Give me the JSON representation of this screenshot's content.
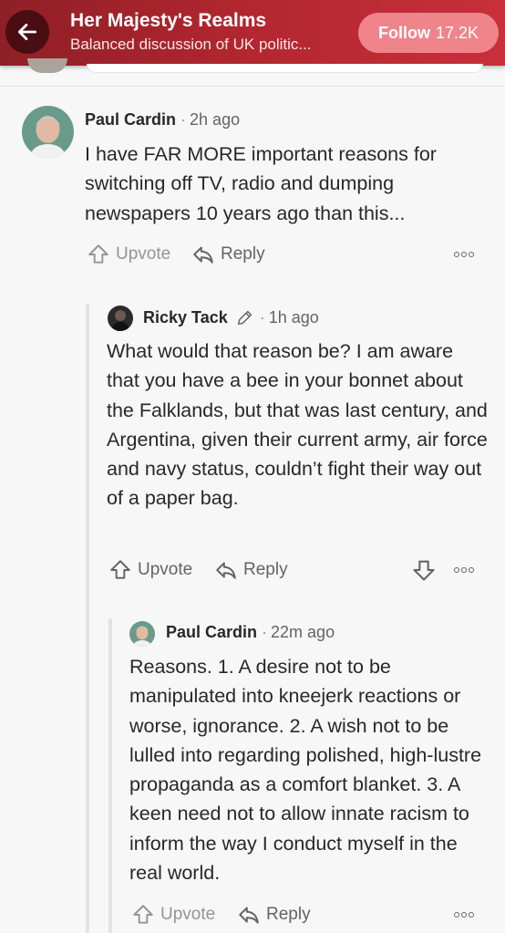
{
  "header": {
    "title": "Her Majesty's Realms",
    "subtitle": "Balanced discussion of UK politic...",
    "follow_label": "Follow",
    "follow_count": "17.2K",
    "accent": "#b0262f"
  },
  "comments": [
    {
      "author": "Paul Cardin",
      "time": "2h ago",
      "body": "I have FAR MORE important reasons for switching off TV, radio and dumping newspapers 10 years ago than this...",
      "upvote_label": "Upvote",
      "reply_label": "Reply"
    },
    {
      "author": "Ricky Tack",
      "badge_icon": "pencil-icon",
      "time": "1h ago",
      "body": "What would that reason be? I am aware that you have a bee in your bonnet about the Falklands, but that was last century, and Argentina, given their current army, air force and navy status, couldn’t fight their way out of a paper bag.",
      "upvote_label": "Upvote",
      "reply_label": "Reply"
    },
    {
      "author": "Paul Cardin",
      "time": "22m ago",
      "body": "Reasons. 1. A desire not to be manipulated into kneejerk reactions or worse, ignorance. 2. A wish not to be lulled into regarding polished, high-lustre propaganda as a comfort blanket. 3. A keen need not to allow innate racism to inform the way I conduct myself in the real world.",
      "upvote_label": "Upvote",
      "reply_label": "Reply"
    }
  ]
}
